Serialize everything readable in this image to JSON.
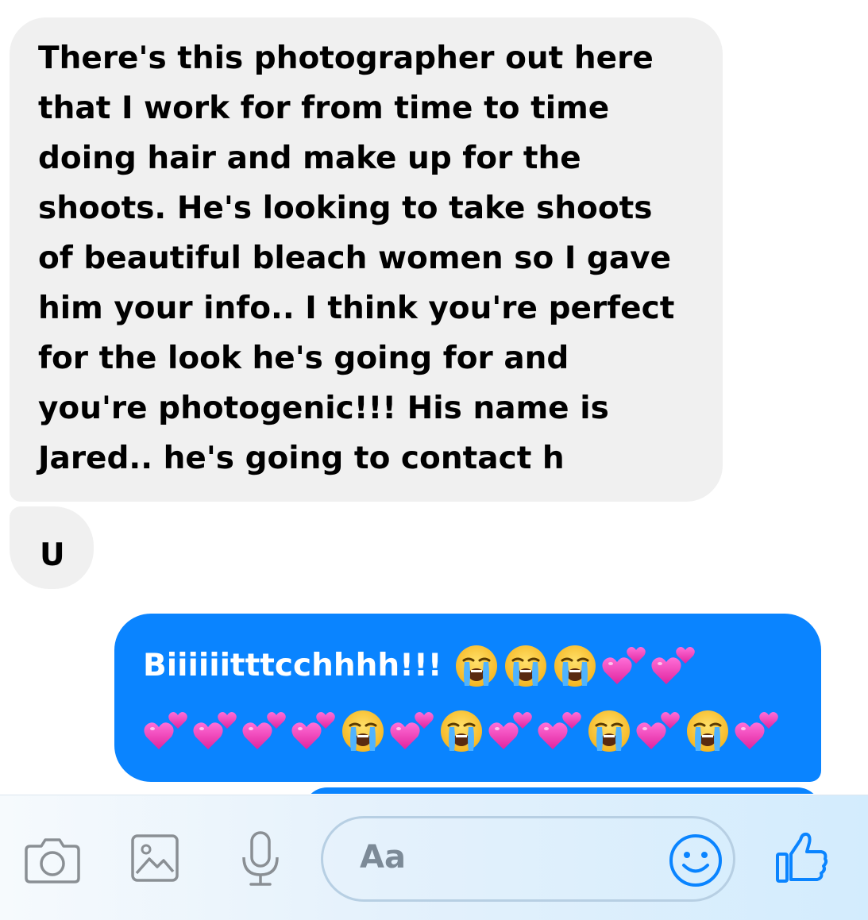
{
  "messages": {
    "received_1_lines": [
      "There's this photographer out here",
      "that I work for from time to time",
      "doing hair and make up for the",
      "shoots. He's looking to take shoots",
      "of beautiful bleach women so I gave",
      "him your info.. I think you're perfect",
      "for the look he's going for and",
      "you're photogenic!!! His name is",
      "Jared.. he's going to contact h"
    ],
    "received_2": "U",
    "sent_1": {
      "text": "Biiiiiitttcchhhh!!!",
      "row1_emojis": [
        "crying-face",
        "crying-face",
        "crying-face",
        "two-hearts",
        "two-hearts"
      ],
      "row2_emojis": [
        "two-hearts",
        "two-hearts",
        "two-hearts",
        "two-hearts",
        "crying-face",
        "two-hearts",
        "crying-face",
        "two-hearts",
        "two-hearts",
        "crying-face",
        "two-hearts",
        "crying-face",
        "two-hearts"
      ]
    }
  },
  "composer": {
    "placeholder": "Aa",
    "icons": [
      "camera-icon",
      "photo-icon",
      "mic-icon",
      "emoji-icon",
      "thumbs-up-icon"
    ]
  },
  "colors": {
    "incoming_bubble": "#f0f0f0",
    "outgoing_bubble": "#0a84ff",
    "accent": "#0a84ff",
    "icon_gray": "#8a8f94"
  }
}
